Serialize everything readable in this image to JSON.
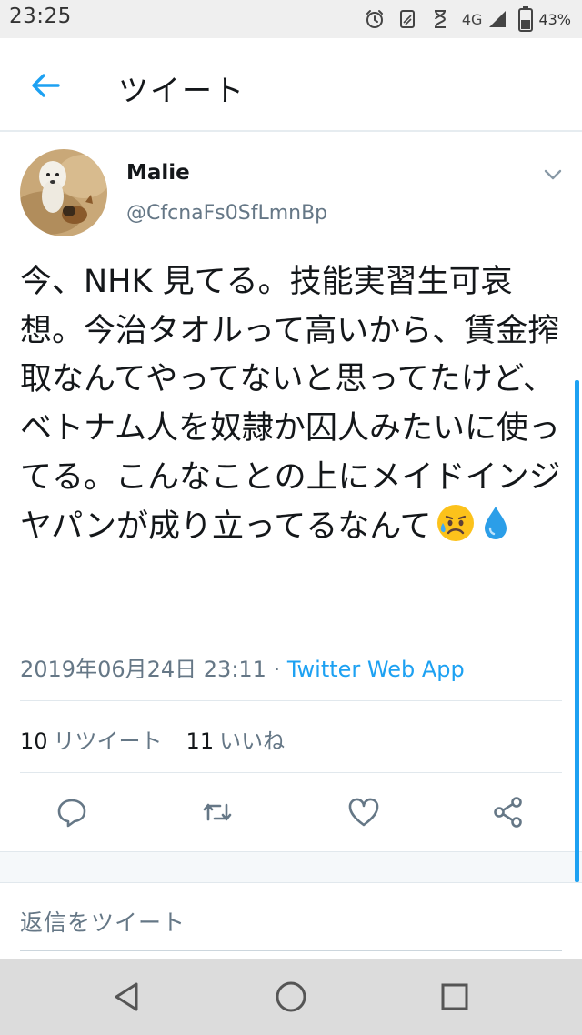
{
  "status_bar": {
    "time": "23:25",
    "network": "4G",
    "battery": "43%"
  },
  "app_bar": {
    "title": "ツイート",
    "back_icon": "arrow-left-icon"
  },
  "tweet": {
    "author_name": "Malie",
    "author_handle": "@CfcnaFs0SfLmnBp",
    "text": "今、NHK 見てる。技能実習生可哀想。今治タオルって高いから、賃金搾取なんてやってないと思ってたけど、ベトナム人を奴隷か囚人みたいに使ってる。こんなことの上にメイドインジヤパンが成り立ってるなんて",
    "timestamp": "2019年06月24日 23:11",
    "separator": " · ",
    "source": "Twitter Web App",
    "retweet_count": "10",
    "retweet_label": "リツイート",
    "like_count": "11",
    "like_label": "いいね"
  },
  "reply": {
    "placeholder": "返信をツイート"
  },
  "colors": {
    "accent": "#1da1f2",
    "secondary_text": "#657786",
    "primary_text": "#14171a",
    "divider": "#e1e8ed"
  },
  "icons": {
    "reply": "reply-icon",
    "retweet": "retweet-icon",
    "like": "heart-icon",
    "share": "share-icon",
    "caret": "chevron-down-icon",
    "nav_back": "triangle-back-icon",
    "nav_home": "circle-home-icon",
    "nav_recent": "square-recents-icon"
  }
}
